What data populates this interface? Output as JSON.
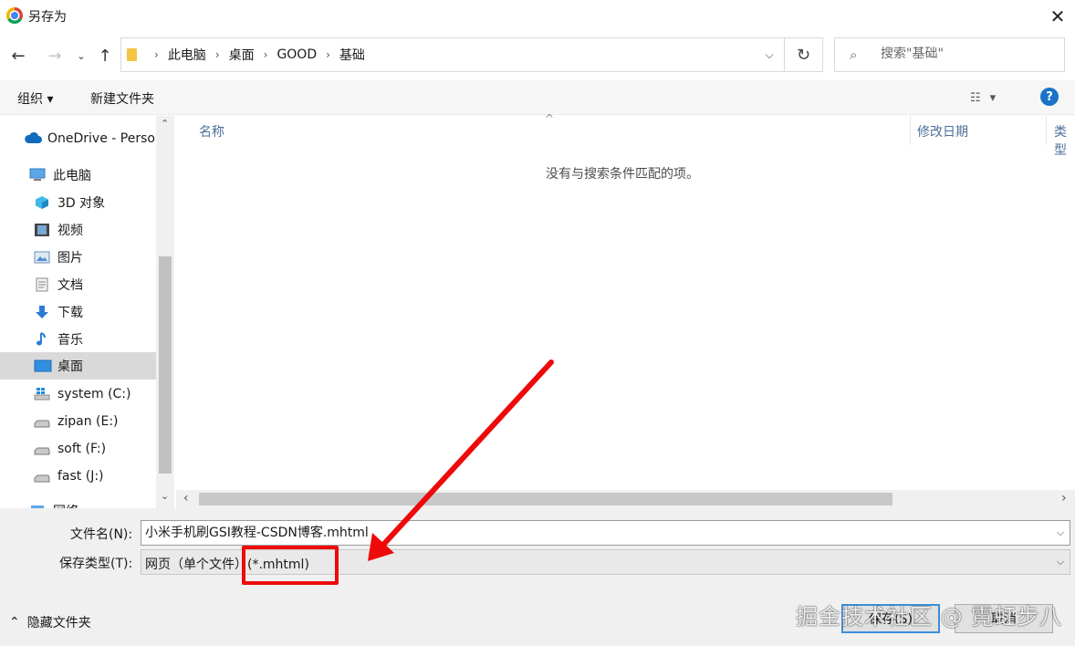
{
  "window": {
    "title": "另存为",
    "close_glyph": "✕"
  },
  "nav": {
    "back_glyph": "←",
    "forward_glyph": "→",
    "recent_glyph": "⌄",
    "up_glyph": "↑",
    "breadcrumbs": [
      "此电脑",
      "桌面",
      "GOOD",
      "基础"
    ],
    "separator_glyph": "›",
    "dropdown_glyph": "⌵",
    "refresh_glyph": "↻"
  },
  "search": {
    "placeholder": "搜索\"基础\"",
    "icon": "search-icon",
    "glyph": "⌕"
  },
  "toolbar": {
    "organize_label": "组织 ▾",
    "new_folder_label": "新建文件夹",
    "view_glyph": "☷",
    "view_caret": "▾",
    "help_glyph": "?"
  },
  "sidebar": {
    "items": [
      {
        "label": "OneDrive - Perso",
        "icon": "cloud-icon"
      },
      {
        "label": "此电脑",
        "icon": "computer-icon"
      },
      {
        "label": "3D 对象",
        "icon": "cube-icon"
      },
      {
        "label": "视频",
        "icon": "video-icon"
      },
      {
        "label": "图片",
        "icon": "image-icon"
      },
      {
        "label": "文档",
        "icon": "document-icon"
      },
      {
        "label": "下载",
        "icon": "download-icon"
      },
      {
        "label": "音乐",
        "icon": "music-icon"
      },
      {
        "label": "桌面",
        "icon": "desktop-icon",
        "selected": true
      },
      {
        "label": "system (C:)",
        "icon": "windows-drive-icon"
      },
      {
        "label": "zipan (E:)",
        "icon": "drive-icon"
      },
      {
        "label": "soft (F:)",
        "icon": "drive-icon"
      },
      {
        "label": "fast (J:)",
        "icon": "drive-icon"
      },
      {
        "label": "网络",
        "icon": "network-icon"
      }
    ],
    "scroll_up_glyph": "⌃",
    "scroll_down_glyph": "⌄"
  },
  "filelist": {
    "columns": [
      "名称",
      "修改日期",
      "类型"
    ],
    "sort_glyph": "^",
    "empty_message": "没有与搜索条件匹配的项。",
    "scroll_left_glyph": "‹",
    "scroll_right_glyph": "›"
  },
  "form": {
    "filename_label": "文件名(N):",
    "filename_value": "小米手机刷GSI教程-CSDN博客.mhtml",
    "filetype_label": "保存类型(T):",
    "filetype_value": "网页（单个文件）(*.mhtml)",
    "dropdown_glyph": "⌵",
    "hide_folders_label": "隐藏文件夹",
    "hide_folders_glyph": "⌃",
    "save_label": "保存(S)",
    "cancel_label": "取消"
  },
  "watermark": "掘金技术社区 @ 霓虹步八",
  "colors": {
    "accent": "#1a73c8",
    "annotation_red": "#ee0a0a",
    "selected_bg": "#d9d9d9",
    "column_header": "#4d6f9a"
  }
}
